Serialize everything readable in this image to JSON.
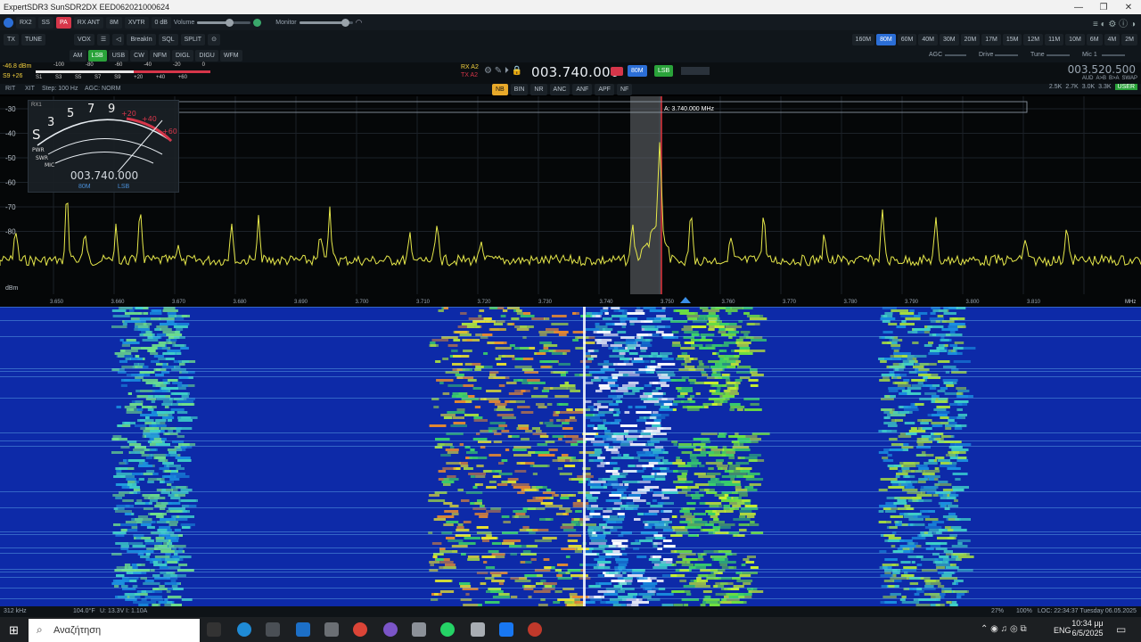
{
  "window": {
    "title": "ExpertSDR3 SunSDR2DX EED062021000624",
    "controls": [
      "—",
      "❐",
      "✕"
    ]
  },
  "toolbar1": {
    "buttons": [
      "RX2",
      "SS",
      "PA",
      "RX ANT",
      "8M",
      "XVTR",
      "0 dB"
    ],
    "volume_label": "Volume",
    "monitor_label": "Monitor",
    "volume_level": 0.6,
    "monitor_level": 0.85
  },
  "toolbar2": {
    "buttons": [
      "TX",
      "TUNE",
      "VOX",
      "BreakIn",
      "SQL",
      "SPLIT"
    ],
    "bands": [
      "160M",
      "80M",
      "60M",
      "40M",
      "30M",
      "20M",
      "17M",
      "15M",
      "12M",
      "11M",
      "10M",
      "6M",
      "4M",
      "2M"
    ],
    "selected_band": "80M"
  },
  "modes": {
    "items": [
      "AM",
      "LSB",
      "USB",
      "CW",
      "NFM",
      "DIGL",
      "DIGU",
      "WFM"
    ],
    "selected": "LSB",
    "agc_label": "AGC",
    "drive_label": "Drive",
    "tune_label": "Tune",
    "mic_label": "Mic 1"
  },
  "meter_strip": {
    "dbm": "-46.8 dBm",
    "s_reading": "S9 +26",
    "scale_top": [
      "-100",
      "-80",
      "-60",
      "-40",
      "-20",
      "0"
    ],
    "scale_bottom": [
      "S1",
      "S3",
      "S5",
      "S7",
      "S9",
      "+20",
      "+40",
      "+60"
    ]
  },
  "vfo": {
    "rx": "RX A2",
    "tx": "TX A2",
    "frequency": "003.740.000",
    "band_badge": "80M",
    "mode_badge": "LSB",
    "sub_frequency": "003.520.500",
    "sub_tags": [
      "AUD",
      "A>B",
      "B>A",
      "SWAP"
    ]
  },
  "row4": {
    "rit": "RIT",
    "xit": "XIT",
    "step": "Step: 100 Hz",
    "agc": "AGC: NORM",
    "filters": [
      "NB",
      "BIN",
      "NR",
      "ANC",
      "ANF",
      "APF",
      "NF"
    ],
    "active_filter": "NB",
    "bandwidths": [
      "2.5K",
      "2.7K",
      "3.0K",
      "3.3K",
      "USER"
    ]
  },
  "spectrum": {
    "db_labels": [
      "-30",
      "-40",
      "-50",
      "-60",
      "-70",
      "-80"
    ],
    "unit": "dBm",
    "marker": "A: 3.740.000 MHz",
    "freq_labels": [
      "3.650",
      "3.660",
      "3.670",
      "3.680",
      "3.690",
      "3.700",
      "3.710",
      "3.720",
      "3.730",
      "3.740",
      "3.750",
      "3.760",
      "3.770",
      "3.780",
      "3.790",
      "3.800",
      "3.810"
    ],
    "mhz": "MHz"
  },
  "smeter": {
    "label": "RX1",
    "freq": "003.740.000",
    "band": "80M",
    "mode": "LSB",
    "scale": [
      "S",
      "3",
      "5",
      "7",
      "9",
      "+20",
      "+40",
      "+60"
    ],
    "pwr": "PWR",
    "swr": "SWR",
    "mic": "MIC"
  },
  "status": {
    "left": "312 kHz",
    "voltage": "U: 13.3V  I: 1.10A",
    "temp": "104.0°F",
    "right_info": "LOC: 22:34:37  Tuesday 06.05.2025",
    "cpu": "27%",
    "percent": "100%"
  },
  "taskbar": {
    "search_placeholder": "Αναζήτηση",
    "lang": "ENG",
    "time": "10:34 μμ",
    "date": "6/5/2025"
  }
}
